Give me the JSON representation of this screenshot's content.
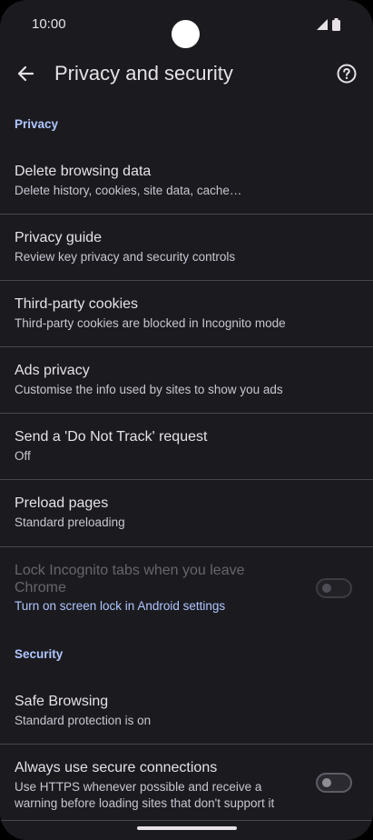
{
  "status_bar": {
    "time": "10:00"
  },
  "app_bar": {
    "title": "Privacy and security"
  },
  "sections": {
    "privacy_header": "Privacy",
    "security_header": "Security"
  },
  "rows": {
    "delete_browsing_data": {
      "title": "Delete browsing data",
      "subtitle": "Delete history, cookies, site data, cache…"
    },
    "privacy_guide": {
      "title": "Privacy guide",
      "subtitle": "Review key privacy and security controls"
    },
    "third_party_cookies": {
      "title": "Third-party cookies",
      "subtitle": "Third-party cookies are blocked in Incognito mode"
    },
    "ads_privacy": {
      "title": "Ads privacy",
      "subtitle": "Customise the info used by sites to show you ads"
    },
    "do_not_track": {
      "title": "Send a 'Do Not Track' request",
      "subtitle": "Off"
    },
    "preload_pages": {
      "title": "Preload pages",
      "subtitle": "Standard preloading"
    },
    "lock_incognito": {
      "title_line1": "Lock Incognito tabs when you leave",
      "title_line2": "Chrome",
      "subtitle": "Turn on screen lock in Android settings",
      "enabled": false,
      "checked": false
    },
    "safe_browsing": {
      "title": "Safe Browsing",
      "subtitle": "Standard protection is on"
    },
    "secure_connections": {
      "title": "Always use secure connections",
      "subtitle_line1": "Use HTTPS whenever possible and receive a",
      "subtitle_line2": "warning before loading sites that don't support it",
      "checked": false
    }
  },
  "colors": {
    "background": "#1b1b1f",
    "accent": "#b0c6ff",
    "text_primary": "#e6e1e5",
    "text_secondary": "#c8c5d0"
  }
}
